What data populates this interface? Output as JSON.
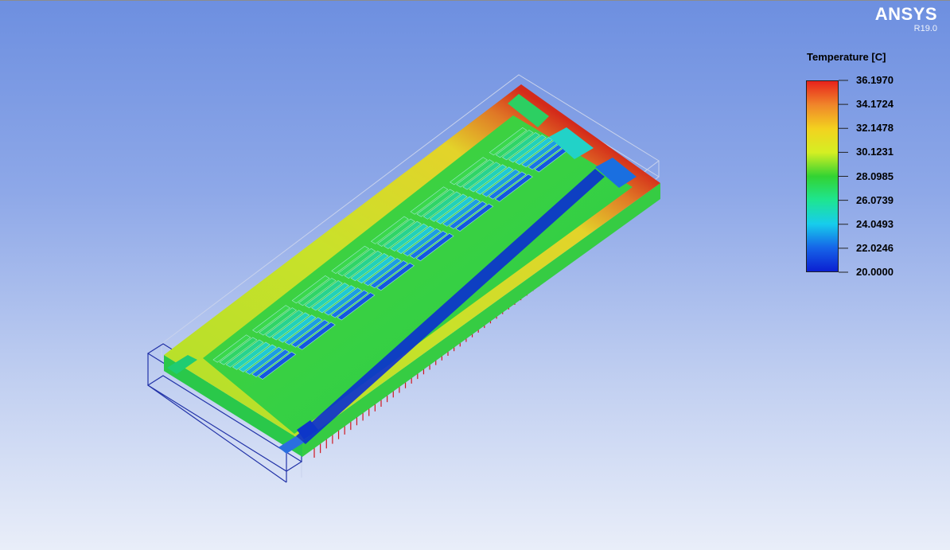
{
  "brand": {
    "name": "ANSYS",
    "version": "R19.0"
  },
  "legend": {
    "title": "Temperature [C]",
    "labels": [
      "36.1970",
      "34.1724",
      "32.1478",
      "30.1231",
      "28.0985",
      "26.0739",
      "24.0493",
      "22.0246",
      "20.0000"
    ],
    "colors": [
      "#e8231c",
      "#f0862a",
      "#f3d21f",
      "#d5ef23",
      "#33d332",
      "#1ee591",
      "#17cdec",
      "#1665e8",
      "#0b1fd2"
    ]
  },
  "model": {
    "surface_colors": {
      "hot_corner": "#d42a1a",
      "warm": "#e3d32a",
      "mid": "#3bd438",
      "cool": "#1ed6c2",
      "cold": "#1240d0"
    },
    "boundary_color": "#d01820"
  }
}
